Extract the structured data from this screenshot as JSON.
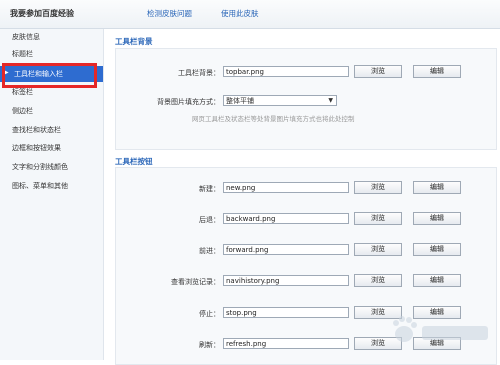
{
  "header": {
    "title": "我要参加百度经验",
    "links": [
      "检测皮肤问题",
      "使用此皮肤"
    ]
  },
  "sidebar": {
    "items": [
      {
        "label": "皮肤信息",
        "active": false
      },
      {
        "label": "标题栏",
        "active": false
      },
      {
        "label": "工具栏和输入栏",
        "active": true
      },
      {
        "label": "标签栏",
        "active": false
      },
      {
        "label": "侧边栏",
        "active": false
      },
      {
        "label": "查找栏和状态栏",
        "active": false
      },
      {
        "label": "边框和按钮效果",
        "active": false
      },
      {
        "label": "文字和分割线颜色",
        "active": false
      },
      {
        "label": "图标、菜单和其他",
        "active": false
      }
    ]
  },
  "toolbar_bg": {
    "section_title": "工具栏背景",
    "bg_label": "工具栏背景：",
    "bg_value": "topbar.png",
    "fill_label": "背景图片填充方式：",
    "fill_value": "整体平铺",
    "note": "网页工具栏及状态栏等处背景图片填充方式也将此处控制"
  },
  "toolbar_btn": {
    "section_title": "工具栏按钮",
    "rows": [
      {
        "label": "新建：",
        "value": "new.png"
      },
      {
        "label": "后退：",
        "value": "backward.png"
      },
      {
        "label": "前进：",
        "value": "forward.png"
      },
      {
        "label": "查看浏览记录：",
        "value": "navihistory.png"
      },
      {
        "label": "停止：",
        "value": "stop.png"
      },
      {
        "label": "刷新：",
        "value": "refresh.png"
      }
    ]
  },
  "buttons": {
    "browse": "浏览",
    "edit": "编辑"
  },
  "colors": {
    "accent": "#2e6cd0",
    "highlight": "#e52727",
    "link": "#2a66b8"
  }
}
